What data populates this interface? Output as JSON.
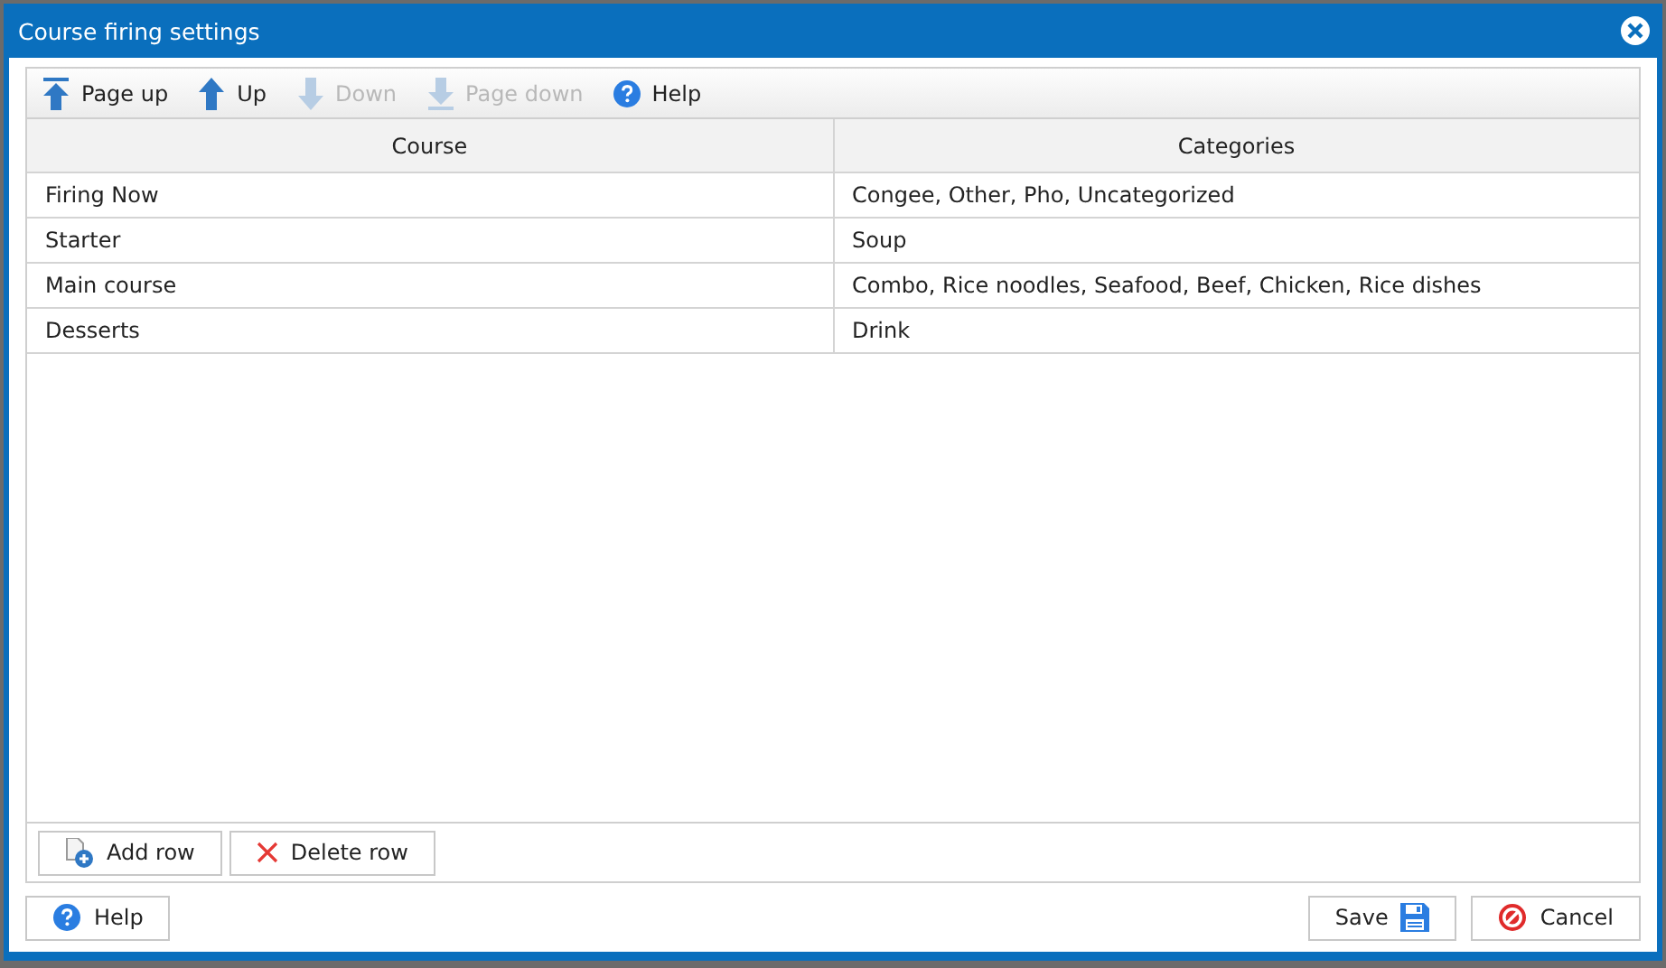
{
  "window": {
    "title": "Course firing settings"
  },
  "toolbar": [
    {
      "kind": "page-up",
      "label": "Page up",
      "disabled": false
    },
    {
      "kind": "up",
      "label": "Up",
      "disabled": false
    },
    {
      "kind": "down",
      "label": "Down",
      "disabled": true
    },
    {
      "kind": "page-down",
      "label": "Page down",
      "disabled": true
    },
    {
      "kind": "help",
      "label": "Help",
      "disabled": false
    }
  ],
  "table": {
    "columns": [
      "Course",
      "Categories"
    ],
    "rows": [
      [
        "Firing Now",
        "Congee, Other, Pho, Uncategorized"
      ],
      [
        "Starter",
        "Soup"
      ],
      [
        "Main course",
        "Combo, Rice noodles, Seafood, Beef, Chicken, Rice dishes"
      ],
      [
        "Desserts",
        "Drink"
      ]
    ]
  },
  "row_actions": [
    {
      "kind": "add",
      "label": "Add row"
    },
    {
      "kind": "delete",
      "label": "Delete row"
    }
  ],
  "footer": {
    "left": [
      {
        "kind": "help",
        "label": "Help"
      }
    ],
    "right": [
      {
        "kind": "save",
        "label": "Save"
      },
      {
        "kind": "cancel",
        "label": "Cancel"
      }
    ]
  }
}
